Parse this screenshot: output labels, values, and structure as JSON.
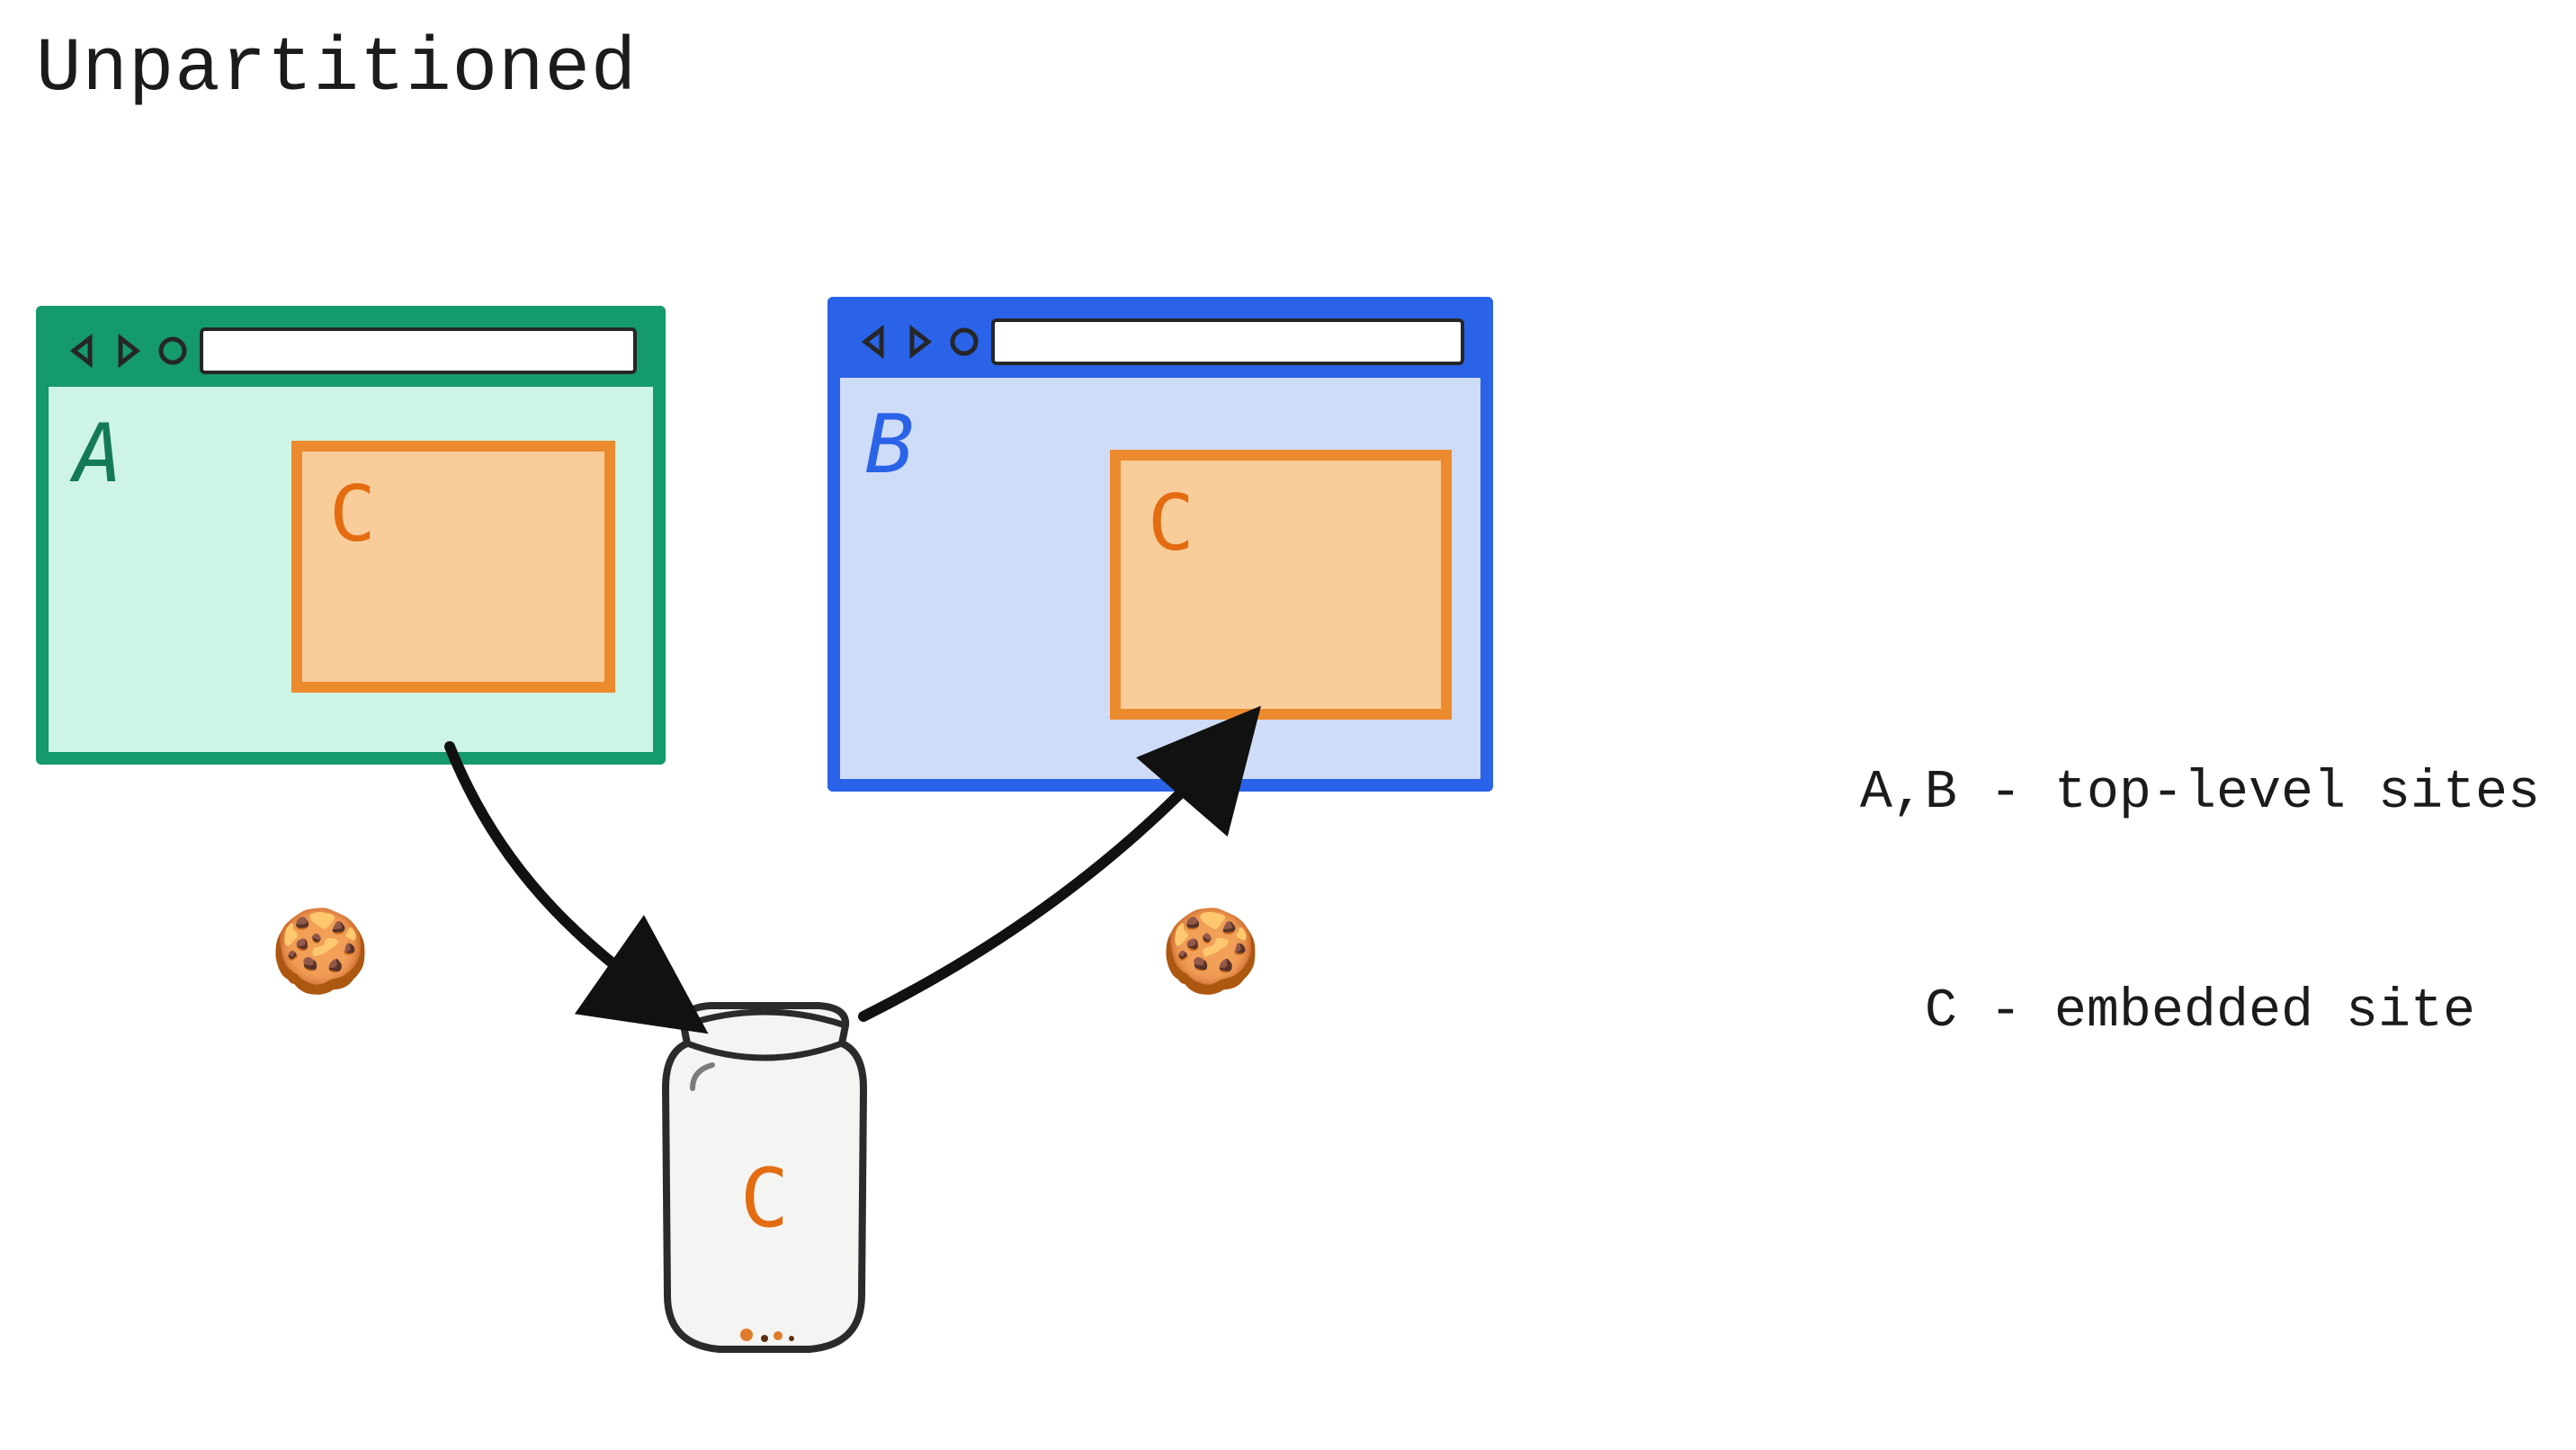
{
  "title": "Unpartitioned",
  "legend": {
    "line1": "A,B - top-level sites",
    "line2": "  C - embedded site"
  },
  "browser_a": {
    "site_label": "A",
    "iframe_label": "C"
  },
  "browser_b": {
    "site_label": "B",
    "iframe_label": "C"
  },
  "jar": {
    "label": "C"
  },
  "cookies": {
    "left_glyph": "🍪",
    "right_glyph": "🍪"
  },
  "colors": {
    "green": "#159a6b",
    "green_body": "#cdf4e5",
    "blue": "#2a63e8",
    "blue_body": "#cfdcf7",
    "orange": "#ec8a2e",
    "orange_fill": "#f8cd9a",
    "orange_text": "#e46c10",
    "stroke": "#1b1b1b"
  }
}
